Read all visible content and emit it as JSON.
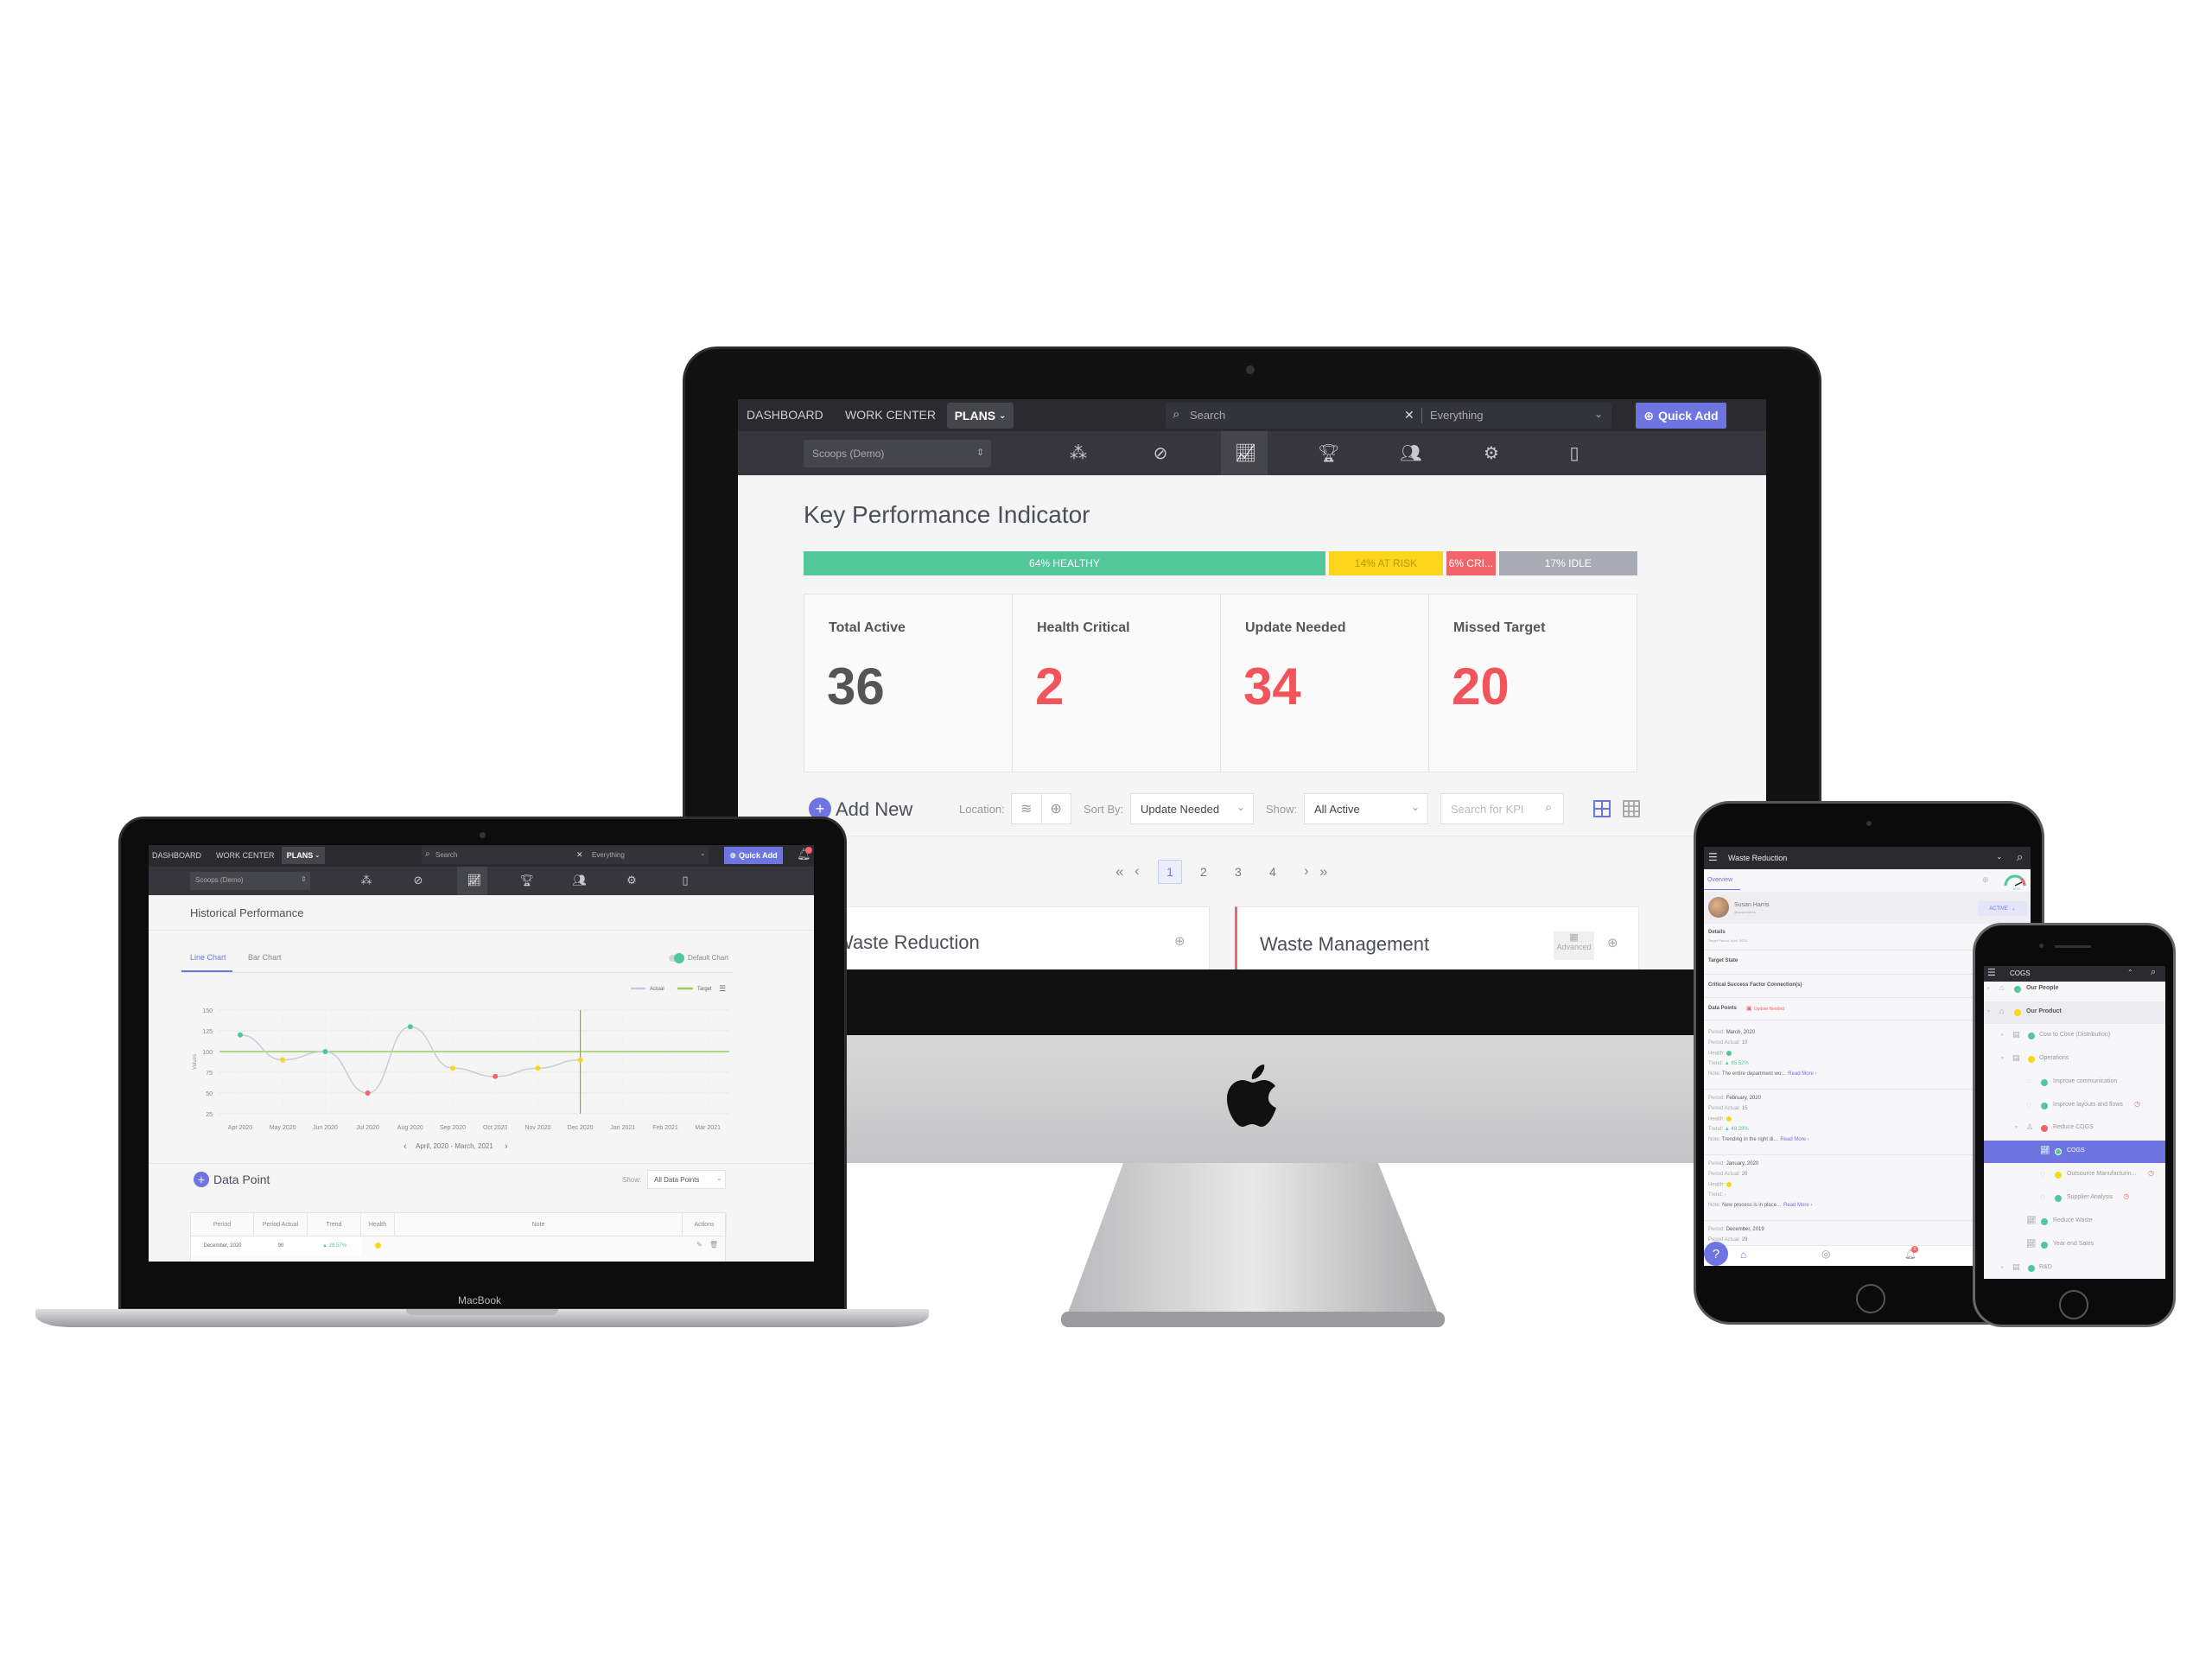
{
  "colors": {
    "accent": "#6e74e0",
    "healthy": "#52c79a",
    "at_risk": "#fcd61a",
    "critical": "#f2646a",
    "idle": "#a9acb4",
    "nav": "#2a2a2f",
    "toolbar": "#36363c"
  },
  "imac": {
    "nav": {
      "items": [
        "DASHBOARD",
        "WORK CENTER"
      ],
      "plans": "PLANS",
      "search_placeholder": "Search",
      "scope": "Everything",
      "quick_add": "Quick Add"
    },
    "toolbar": {
      "org": "Scoops (Demo)",
      "icons": [
        "network-icon",
        "compass-icon",
        "kpi-chart-icon",
        "trophy-icon",
        "people-icon",
        "gears-icon",
        "document-icon"
      ],
      "active_icon": "kpi-chart-icon"
    },
    "title": "Key Performance Indicator",
    "health_bar": [
      {
        "label": "64% HEALTHY",
        "percent": 64,
        "color": "#52c79a",
        "text_color": "#ffffff"
      },
      {
        "label": "14% AT RISK",
        "percent": 14,
        "color": "#fcd61a",
        "text_color": "#b79a10"
      },
      {
        "label": "6% CRI...",
        "percent": 6,
        "color": "#f2646a",
        "text_color": "#ffffff"
      },
      {
        "label": "17% IDLE",
        "percent": 17,
        "color": "#a9acb4",
        "text_color": "#ffffff"
      }
    ],
    "stats": [
      {
        "label": "Total Active",
        "value": "36",
        "color": "#555555"
      },
      {
        "label": "Health Critical",
        "value": "2",
        "color": "#f2545b"
      },
      {
        "label": "Update Needed",
        "value": "34",
        "color": "#f2545b"
      },
      {
        "label": "Missed Target",
        "value": "20",
        "color": "#f2545b"
      }
    ],
    "filters": {
      "add_new": "Add New",
      "location_label": "Location:",
      "sort_label": "Sort By:",
      "sort_value": "Update Needed",
      "show_label": "Show:",
      "show_value": "All Active",
      "search_placeholder": "Search for KPI"
    },
    "pagination": {
      "first": "«",
      "prev": "‹",
      "pages": [
        "1",
        "2",
        "3",
        "4"
      ],
      "current": "1",
      "next": "›",
      "last": "»"
    },
    "cards": [
      {
        "title": "Waste Reduction"
      },
      {
        "title": "Waste Management",
        "badge": "Advanced"
      }
    ]
  },
  "macbook": {
    "label": "MacBook",
    "nav": {
      "items": [
        "DASHBOARD",
        "WORK CENTER"
      ],
      "plans": "PLANS",
      "search_placeholder": "Search",
      "scope": "Everything",
      "quick_add": "Quick Add"
    },
    "toolbar": {
      "org": "Scoops (Demo)"
    },
    "section_title": "Historical Performance",
    "tabs": [
      "Line Chart",
      "Bar Chart"
    ],
    "active_tab": "Line Chart",
    "toggle_label": "Default Chart",
    "toggle_on": true,
    "date_range": "April, 2020 - March, 2021",
    "data_point": {
      "title": "Data Point",
      "show_label": "Show:",
      "show_value": "All Data Points"
    },
    "table": {
      "headers": [
        "Period",
        "Period Actual",
        "Trend",
        "Health",
        "Note",
        "Actions"
      ],
      "rows": [
        {
          "period": "December, 2020",
          "actual": "90",
          "trend": "▲ 28.57%",
          "health": "at_risk",
          "note": ""
        }
      ]
    }
  },
  "chart_data": {
    "type": "line",
    "categories": [
      "Apr 2020",
      "May 2020",
      "Jun 2020",
      "Jul 2020",
      "Aug 2020",
      "Sep 2020",
      "Oct 2020",
      "Nov 2020",
      "Dec 2020",
      "Jan 2021",
      "Feb 2021",
      "Mar 2021"
    ],
    "series": [
      {
        "name": "Actual",
        "values": [
          120,
          90,
          100,
          50,
          130,
          80,
          70,
          80,
          90,
          null,
          null,
          null
        ],
        "color": "#c9ccd8"
      },
      {
        "name": "Target",
        "values": [
          100,
          100,
          100,
          100,
          100,
          100,
          100,
          100,
          100,
          100,
          100,
          100
        ],
        "color": "#9ccc65"
      }
    ],
    "point_health": [
      "healthy",
      "at_risk",
      "healthy",
      "critical",
      "healthy",
      "at_risk",
      "critical",
      "at_risk",
      "at_risk"
    ],
    "current_period": "Dec 2020",
    "ylabel": "Values",
    "ylim": [
      25,
      150
    ],
    "yticks": [
      150,
      125,
      100,
      75,
      50,
      25
    ],
    "grid": true,
    "legend": "top-right"
  },
  "tablet": {
    "title": "Waste Reduction",
    "tab": "Overview",
    "gauge_label": "10 %",
    "owner": {
      "name": "Susan Harris",
      "handle": "@susanharris"
    },
    "status": "ACTIVE",
    "sections": [
      {
        "title": "Details",
        "sub": "Target Period: April, 2020"
      },
      {
        "title": "Target State"
      },
      {
        "title": "Critical Success Factor Connection(s)"
      }
    ],
    "data_points_title": "Data Points",
    "update_badge": "Update Needed",
    "entries": [
      {
        "period": "March, 2020",
        "actual": "10",
        "health": "healthy",
        "trend": "▲ 65.52%",
        "note": "The entire department wo...",
        "more": "Read More ›"
      },
      {
        "period": "February, 2020",
        "actual": "15",
        "health": "at_risk",
        "trend": "▲ 48.28%",
        "note": "Trending in the right di...",
        "more": "Read More ›"
      },
      {
        "period": "January, 2020",
        "actual": "20",
        "health": "at_risk",
        "trend": "-",
        "note": "New process is in place...",
        "more": "Read More ›"
      },
      {
        "period": "December, 2019",
        "actual": "29"
      }
    ],
    "labels": {
      "period": "Period:",
      "actual": "Period Actual:",
      "health": "Health:",
      "trend": "Trend:",
      "note": "Note:"
    },
    "notification_count": "0"
  },
  "phone": {
    "title": "COGS",
    "tree": [
      {
        "label": "Our People",
        "level": 0,
        "health": "healthy",
        "icon": "building-icon",
        "arrow": "right"
      },
      {
        "label": "Our Product",
        "level": 0,
        "health": "at_risk",
        "icon": "building-icon",
        "arrow": "down",
        "highlight": true
      },
      {
        "label": "Cow to Cone (Distribution)",
        "level": 1,
        "health": "healthy",
        "icon": "plan-icon",
        "arrow": "right"
      },
      {
        "label": "Operations",
        "level": 1,
        "health": "at_risk",
        "icon": "plan-icon",
        "arrow": "down"
      },
      {
        "label": "Improve communication",
        "level": 2,
        "health": "healthy",
        "icon": "check-circle-icon"
      },
      {
        "label": "Improve layouts and flows",
        "level": 2,
        "health": "healthy",
        "icon": "check-circle-icon",
        "overdue": true
      },
      {
        "label": "Reduce COGS",
        "level": 2,
        "health": "critical",
        "icon": "person-icon",
        "arrow": "down"
      },
      {
        "label": "COGS",
        "level": 3,
        "health": "healthy",
        "icon": "kpi-chart-icon",
        "selected": true
      },
      {
        "label": "Outsource Manufacturin...",
        "level": 3,
        "health": "at_risk",
        "icon": "check-circle-icon",
        "overdue": true
      },
      {
        "label": "Supplier Analysis",
        "level": 3,
        "health": "healthy",
        "icon": "check-circle-icon",
        "overdue": true
      },
      {
        "label": "Reduce Waste",
        "level": 2,
        "health": "healthy",
        "icon": "kpi-chart-icon"
      },
      {
        "label": "Year end Sales",
        "level": 2,
        "health": "healthy",
        "icon": "kpi-chart-icon"
      },
      {
        "label": "R&D",
        "level": 1,
        "health": "healthy",
        "icon": "plan-icon",
        "arrow": "right"
      }
    ]
  }
}
